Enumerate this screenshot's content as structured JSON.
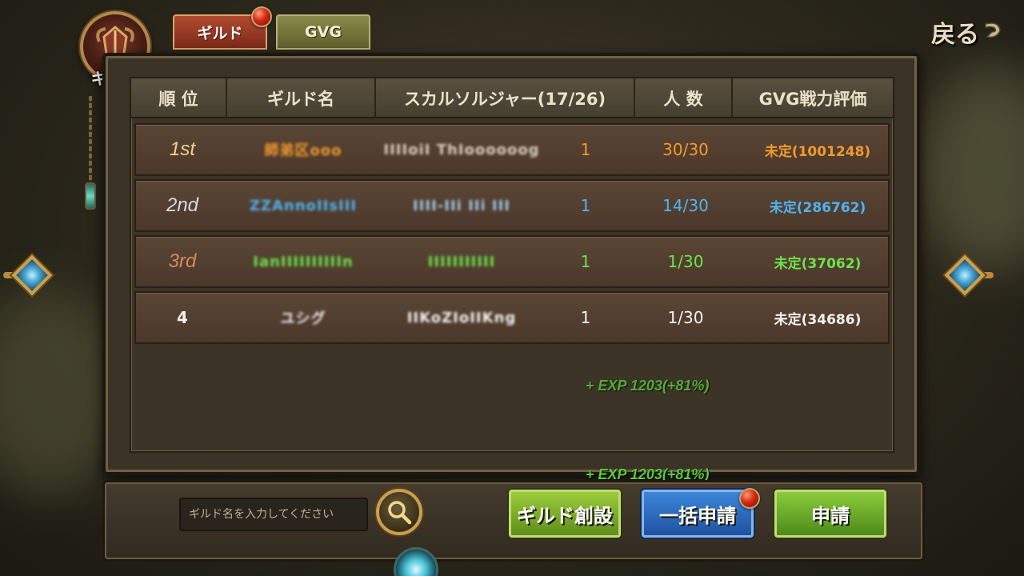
{
  "colors": {
    "rank1": "#f29a2e",
    "rank2": "#4fb3f2",
    "rank3": "#6be34b",
    "rank4": "#f2f2f2",
    "rank1_label": "#f3d28a",
    "rank2_label": "#d8d8e8",
    "rank3_label": "#d8895a",
    "exp_green": "#5cc93c"
  },
  "top_tabs": [
    {
      "label": "ギルド",
      "active": true,
      "has_notification": true
    },
    {
      "label": "GVG",
      "active": false,
      "has_notification": false
    }
  ],
  "emblem": {
    "label": "ギルド",
    "icon": "guild-crest-icon"
  },
  "back_button": {
    "label": "戻る",
    "icon": "back-arrow-icon"
  },
  "table": {
    "headers": [
      "順 位",
      "ギルド名",
      "スカルソルジャー(17/26)",
      "人 数",
      "GVG戦力評価"
    ],
    "rows": [
      {
        "rank": "1st",
        "guild_name": "師弟区ooo",
        "master": "IIIIoiI ThIoooooog",
        "level": "1",
        "members": "30/30",
        "gvg_power": "未定(1001248)"
      },
      {
        "rank": "2nd",
        "guild_name": "ZZAnnoIIsIII",
        "master": "IIII-IIi IIi III",
        "level": "1",
        "members": "14/30",
        "gvg_power": "未定(286762)"
      },
      {
        "rank": "3rd",
        "guild_name": "IanIIIIIIIIIIn",
        "master": "IIIIIIIIIII",
        "level": "1",
        "members": "1/30",
        "gvg_power": "未定(37062)"
      },
      {
        "rank": "4",
        "guild_name": "ユシグ",
        "master": "IIKoZIoIIKng",
        "level": "1",
        "members": "1/30",
        "gvg_power": "未定(34686)"
      }
    ]
  },
  "exp_popups": [
    "+ EXP 1203(+81%)",
    "+ EXP 1203(+81%)"
  ],
  "search": {
    "placeholder": "ギルド名を入力してください",
    "value": "",
    "icon": "magnifier-icon"
  },
  "buttons": {
    "create": "ギルド創設",
    "bulk_apply": "一括申請",
    "apply": "申請"
  },
  "side_arrows": {
    "left_icon": "left-nav-diamond-icon",
    "right_icon": "right-nav-diamond-icon"
  }
}
